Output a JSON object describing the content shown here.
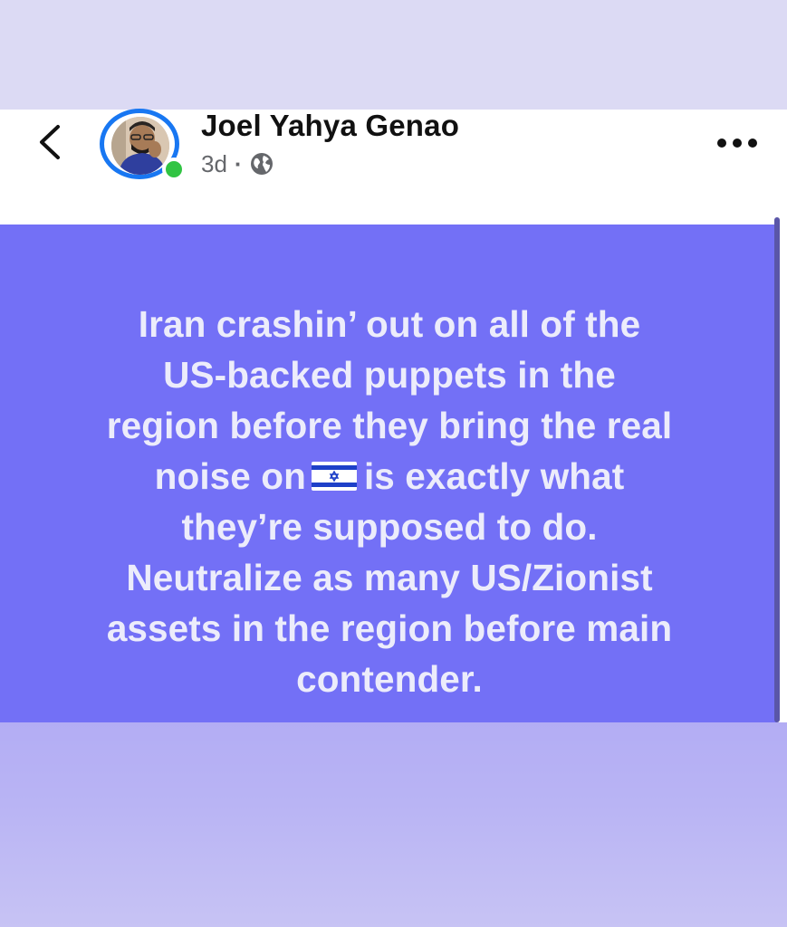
{
  "post": {
    "author_name": "Joel Yahya Genao",
    "time": "3d",
    "separator": "·",
    "privacy_icon": "globe-icon",
    "more_icon": "more-options-icon",
    "back_icon": "chevron-left-icon",
    "text_lines": [
      "Iran crashin’ out on all of the",
      "US-backed puppets in the",
      "region before they bring the real",
      "noise on",
      "is exactly what",
      "they’re supposed to do.",
      "Neutralize as many US/Zionist",
      "assets in the region before main",
      "contender."
    ],
    "flag_icon": "israel-flag-icon"
  },
  "colors": {
    "post_background": "#7370f6",
    "post_text": "#ececfb",
    "avatar_ring": "#1877f2",
    "online_dot": "#31c443",
    "top_band": "#dcdaf4",
    "bottom_band": "#b3adf4"
  }
}
